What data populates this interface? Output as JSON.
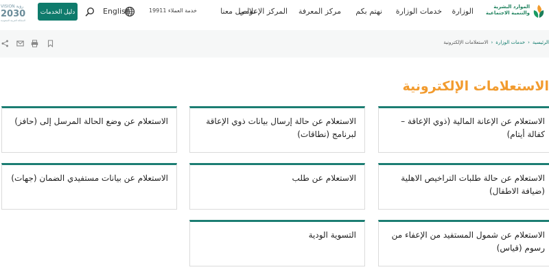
{
  "header": {
    "logo": {
      "line1": "الموارد البشرية",
      "line2": "والتنمية الاجتماعية"
    },
    "nav": [
      "الوزارة",
      "خدمات الوزارة",
      "نهتم بكم",
      "مركز المعرفة",
      "المركز الإعلامي",
      "تواصل معنا"
    ],
    "hotline": "خدمة العملاء 19911",
    "language": "English",
    "guide_button": "دليل الخدمات",
    "vision": {
      "top": "VISION رؤية",
      "year": "2030",
      "bottom": "المملكة العربية السعودية"
    }
  },
  "breadcrumb": [
    "الرئيسية",
    "خدمات الوزارة",
    "الاستعلامات الإلكترونية"
  ],
  "page_title": "الاستعلامات الإلكترونية",
  "cards": [
    "الاستعلام عن الإعانة المالية (ذوي الإعاقة – كفالة أيتام)",
    "الاستعلام عن حالة إرسال بيانات ذوي الإعاقة لبرنامج (نطاقات)",
    "الاستعلام عن وضع الحالة المرسل إلى (حافز)",
    "الاستعلام عن حالة طلبات التراخيص الاهلية (ضيافة الاطفال)",
    "الاستعلام عن طلب",
    "الاستعلام عن بيانات مستفيدي الضمان (جهات)",
    "الاستعلام عن شمول المستفيد من الإعفاء من رسوم (قياس)",
    "التسوية الودية"
  ],
  "colors": {
    "primary": "#0f7b6c",
    "card_top": "#1b7d72",
    "title": "#f29b2e",
    "crumb_bg": "#f6f7f7"
  }
}
